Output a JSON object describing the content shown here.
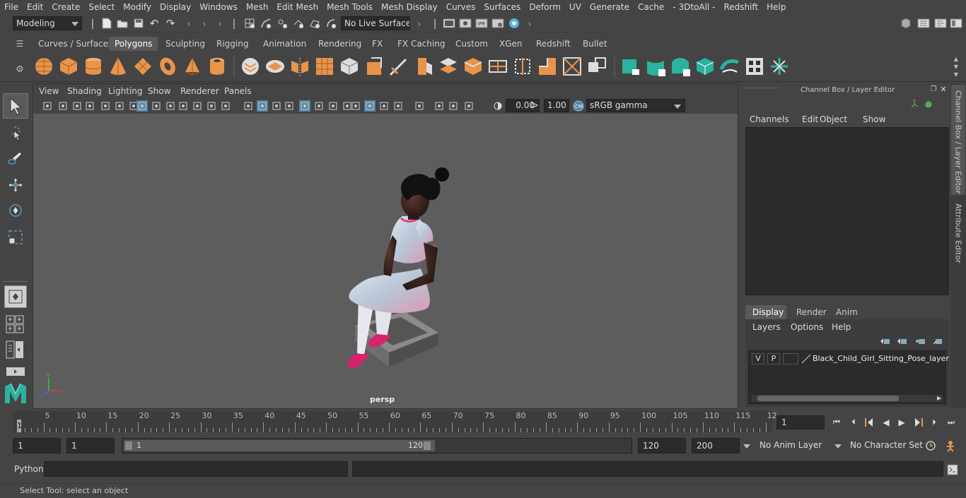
{
  "menu": [
    "File",
    "Edit",
    "Create",
    "Select",
    "Modify",
    "Display",
    "Windows",
    "Mesh",
    "Edit Mesh",
    "Mesh Tools",
    "Mesh Display",
    "Curves",
    "Surfaces",
    "Deform",
    "UV",
    "Generate",
    "Cache",
    "- 3DtoAll -",
    "Redshift",
    "Help"
  ],
  "status": {
    "mode": "Modeling",
    "live_surface": "No Live Surface"
  },
  "shelf_tabs": [
    "Curves / Surfaces",
    "Polygons",
    "Sculpting",
    "Rigging",
    "Animation",
    "Rendering",
    "FX",
    "FX Caching",
    "Custom",
    "XGen",
    "Redshift",
    "Bullet"
  ],
  "shelf_active": "Polygons",
  "viewport": {
    "menus": [
      "View",
      "Shading",
      "Lighting",
      "Show",
      "Renderer",
      "Panels"
    ],
    "exposure": "0.00",
    "gamma": "1.00",
    "color_space": "sRGB gamma",
    "camera": "persp"
  },
  "channel_box": {
    "title": "Channel Box / Layer Editor",
    "menus": [
      "Channels",
      "Edit",
      "Object",
      "Show"
    ]
  },
  "layer_editor": {
    "tabs": [
      "Display",
      "Render",
      "Anim"
    ],
    "active_tab": "Display",
    "menus": [
      "Layers",
      "Options",
      "Help"
    ],
    "layer": {
      "v": "V",
      "p": "P",
      "name": "Black_Child_Girl_Sitting_Pose_layer"
    }
  },
  "side_tabs": [
    "Channel Box / Layer Editor",
    "Attribute Editor"
  ],
  "timeline": {
    "labels": [
      "5",
      "10",
      "15",
      "20",
      "25",
      "30",
      "35",
      "40",
      "45",
      "50",
      "55",
      "60",
      "65",
      "70",
      "75",
      "80",
      "85",
      "90",
      "95",
      "100",
      "105",
      "110",
      "115",
      "12"
    ],
    "current_frame": "1",
    "start_marker": "1"
  },
  "range": {
    "start": "1",
    "playback_start": "1",
    "slider_start": "1",
    "slider_end": "120",
    "playback_end": "120",
    "end": "200",
    "anim_layer": "No Anim Layer",
    "character_set": "No Character Set"
  },
  "command": {
    "label": "Python"
  },
  "help_line": "Select Tool: select an object",
  "colors": {
    "accent": "#5285a6",
    "orange": "#e8944a",
    "teal": "#2ab3a0",
    "viewport_bg": "#5d5d5d"
  }
}
